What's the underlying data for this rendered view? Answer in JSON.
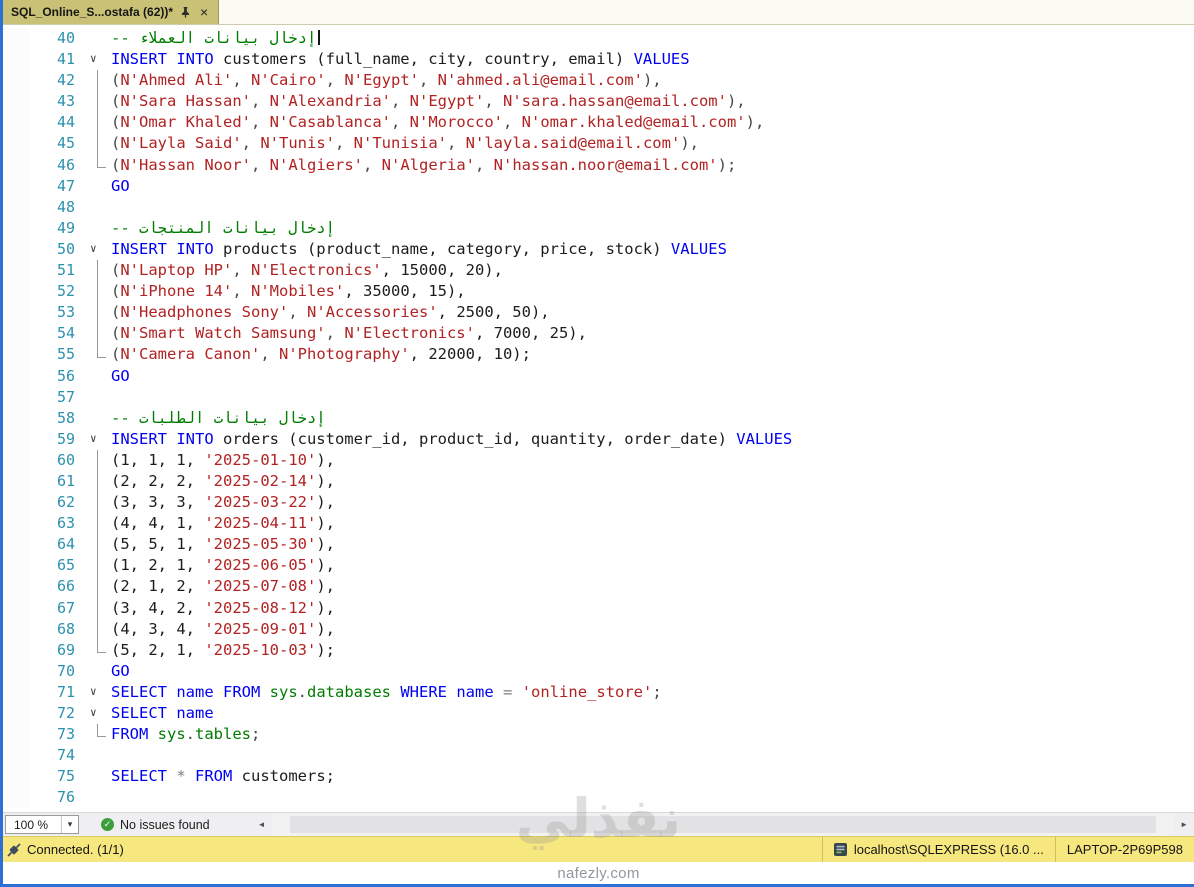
{
  "tab_bar": {
    "title": "SQL_Online_S...ostafa (62))*",
    "close_label": "×"
  },
  "colors": {
    "keyword": "#0000F2",
    "string": "#B22222",
    "comment": "#007C00",
    "line_number": "#2B91AF",
    "tab": "#C9C176",
    "status_bar": "#F6E77E"
  },
  "editor": {
    "lines": [
      {
        "n": 40,
        "g": "",
        "caret": true,
        "s": [
          [
            "-- إدخال بيانات العملاء",
            "c"
          ]
        ]
      },
      {
        "n": 41,
        "g": "start",
        "s": [
          [
            "INSERT INTO",
            "k"
          ],
          [
            " customers (full_name, city, country, email) ",
            "i"
          ],
          [
            "VALUES",
            "k"
          ]
        ]
      },
      {
        "n": 42,
        "g": "mid",
        "s": [
          [
            "(",
            "p"
          ],
          [
            "N'Ahmed Ali'",
            "s"
          ],
          [
            ", ",
            "p"
          ],
          [
            "N'Cairo'",
            "s"
          ],
          [
            ", ",
            "p"
          ],
          [
            "N'Egypt'",
            "s"
          ],
          [
            ", ",
            "p"
          ],
          [
            "N'ahmed.ali@email.com'",
            "s"
          ],
          [
            "),",
            "p"
          ]
        ]
      },
      {
        "n": 43,
        "g": "mid",
        "s": [
          [
            "(",
            "p"
          ],
          [
            "N'Sara Hassan'",
            "s"
          ],
          [
            ", ",
            "p"
          ],
          [
            "N'Alexandria'",
            "s"
          ],
          [
            ", ",
            "p"
          ],
          [
            "N'Egypt'",
            "s"
          ],
          [
            ", ",
            "p"
          ],
          [
            "N'sara.hassan@email.com'",
            "s"
          ],
          [
            "),",
            "p"
          ]
        ]
      },
      {
        "n": 44,
        "g": "mid",
        "s": [
          [
            "(",
            "p"
          ],
          [
            "N'Omar Khaled'",
            "s"
          ],
          [
            ", ",
            "p"
          ],
          [
            "N'Casablanca'",
            "s"
          ],
          [
            ", ",
            "p"
          ],
          [
            "N'Morocco'",
            "s"
          ],
          [
            ", ",
            "p"
          ],
          [
            "N'omar.khaled@email.com'",
            "s"
          ],
          [
            "),",
            "p"
          ]
        ]
      },
      {
        "n": 45,
        "g": "mid",
        "s": [
          [
            "(",
            "p"
          ],
          [
            "N'Layla Said'",
            "s"
          ],
          [
            ", ",
            "p"
          ],
          [
            "N'Tunis'",
            "s"
          ],
          [
            ", ",
            "p"
          ],
          [
            "N'Tunisia'",
            "s"
          ],
          [
            ", ",
            "p"
          ],
          [
            "N'layla.said@email.com'",
            "s"
          ],
          [
            "),",
            "p"
          ]
        ]
      },
      {
        "n": 46,
        "g": "end",
        "s": [
          [
            "(",
            "p"
          ],
          [
            "N'Hassan Noor'",
            "s"
          ],
          [
            ", ",
            "p"
          ],
          [
            "N'Algiers'",
            "s"
          ],
          [
            ", ",
            "p"
          ],
          [
            "N'Algeria'",
            "s"
          ],
          [
            ", ",
            "p"
          ],
          [
            "N'hassan.noor@email.com'",
            "s"
          ],
          [
            ");",
            "p"
          ]
        ]
      },
      {
        "n": 47,
        "g": "",
        "s": [
          [
            "GO",
            "k"
          ]
        ]
      },
      {
        "n": 48,
        "g": "",
        "s": []
      },
      {
        "n": 49,
        "g": "",
        "s": [
          [
            "-- إدخال بيانات المنتجات",
            "c"
          ]
        ]
      },
      {
        "n": 50,
        "g": "start",
        "s": [
          [
            "INSERT INTO",
            "k"
          ],
          [
            " products (product_name, category, price, stock) ",
            "i"
          ],
          [
            "VALUES",
            "k"
          ]
        ]
      },
      {
        "n": 51,
        "g": "mid",
        "s": [
          [
            "(",
            "p"
          ],
          [
            "N'Laptop HP'",
            "s"
          ],
          [
            ", ",
            "p"
          ],
          [
            "N'Electronics'",
            "s"
          ],
          [
            ", 15000, 20),",
            "i"
          ]
        ]
      },
      {
        "n": 52,
        "g": "mid",
        "s": [
          [
            "(",
            "p"
          ],
          [
            "N'iPhone 14'",
            "s"
          ],
          [
            ", ",
            "p"
          ],
          [
            "N'Mobiles'",
            "s"
          ],
          [
            ", 35000, 15),",
            "i"
          ]
        ]
      },
      {
        "n": 53,
        "g": "mid",
        "s": [
          [
            "(",
            "p"
          ],
          [
            "N'Headphones Sony'",
            "s"
          ],
          [
            ", ",
            "p"
          ],
          [
            "N'Accessories'",
            "s"
          ],
          [
            ", 2500, 50),",
            "i"
          ]
        ]
      },
      {
        "n": 54,
        "g": "mid",
        "s": [
          [
            "(",
            "p"
          ],
          [
            "N'Smart Watch Samsung'",
            "s"
          ],
          [
            ", ",
            "p"
          ],
          [
            "N'Electronics'",
            "s"
          ],
          [
            ", 7000, 25),",
            "i"
          ]
        ]
      },
      {
        "n": 55,
        "g": "end",
        "s": [
          [
            "(",
            "p"
          ],
          [
            "N'Camera Canon'",
            "s"
          ],
          [
            ", ",
            "p"
          ],
          [
            "N'Photography'",
            "s"
          ],
          [
            ", 22000, 10);",
            "i"
          ]
        ]
      },
      {
        "n": 56,
        "g": "",
        "s": [
          [
            "GO",
            "k"
          ]
        ]
      },
      {
        "n": 57,
        "g": "",
        "s": []
      },
      {
        "n": 58,
        "g": "",
        "s": [
          [
            "-- إدخال بيانات الطلبات",
            "c"
          ]
        ]
      },
      {
        "n": 59,
        "g": "start",
        "s": [
          [
            "INSERT INTO",
            "k"
          ],
          [
            " orders (customer_id, product_id, quantity, order_date) ",
            "i"
          ],
          [
            "VALUES",
            "k"
          ]
        ]
      },
      {
        "n": 60,
        "g": "mid",
        "s": [
          [
            "(1, 1, 1, ",
            "i"
          ],
          [
            "'2025-01-10'",
            "s"
          ],
          [
            "),",
            "i"
          ]
        ]
      },
      {
        "n": 61,
        "g": "mid",
        "s": [
          [
            "(2, 2, 2, ",
            "i"
          ],
          [
            "'2025-02-14'",
            "s"
          ],
          [
            "),",
            "i"
          ]
        ]
      },
      {
        "n": 62,
        "g": "mid",
        "s": [
          [
            "(3, 3, 3, ",
            "i"
          ],
          [
            "'2025-03-22'",
            "s"
          ],
          [
            "),",
            "i"
          ]
        ]
      },
      {
        "n": 63,
        "g": "mid",
        "s": [
          [
            "(4, 4, 1, ",
            "i"
          ],
          [
            "'2025-04-11'",
            "s"
          ],
          [
            "),",
            "i"
          ]
        ]
      },
      {
        "n": 64,
        "g": "mid",
        "s": [
          [
            "(5, 5, 1, ",
            "i"
          ],
          [
            "'2025-05-30'",
            "s"
          ],
          [
            "),",
            "i"
          ]
        ]
      },
      {
        "n": 65,
        "g": "mid",
        "s": [
          [
            "(1, 2, 1, ",
            "i"
          ],
          [
            "'2025-06-05'",
            "s"
          ],
          [
            "),",
            "i"
          ]
        ]
      },
      {
        "n": 66,
        "g": "mid",
        "s": [
          [
            "(2, 1, 2, ",
            "i"
          ],
          [
            "'2025-07-08'",
            "s"
          ],
          [
            "),",
            "i"
          ]
        ]
      },
      {
        "n": 67,
        "g": "mid",
        "s": [
          [
            "(3, 4, 2, ",
            "i"
          ],
          [
            "'2025-08-12'",
            "s"
          ],
          [
            "),",
            "i"
          ]
        ]
      },
      {
        "n": 68,
        "g": "mid",
        "s": [
          [
            "(4, 3, 4, ",
            "i"
          ],
          [
            "'2025-09-01'",
            "s"
          ],
          [
            "),",
            "i"
          ]
        ]
      },
      {
        "n": 69,
        "g": "end",
        "s": [
          [
            "(5, 2, 1, ",
            "i"
          ],
          [
            "'2025-10-03'",
            "s"
          ],
          [
            ");",
            "i"
          ]
        ]
      },
      {
        "n": 70,
        "g": "",
        "s": [
          [
            "GO",
            "k"
          ]
        ]
      },
      {
        "n": 71,
        "g": "start",
        "s": [
          [
            "SELECT name FROM",
            "k"
          ],
          [
            " ",
            "p"
          ],
          [
            "sys",
            "g"
          ],
          [
            ".",
            "p"
          ],
          [
            "databases",
            "g"
          ],
          [
            " ",
            "p"
          ],
          [
            "WHERE name",
            "k"
          ],
          [
            " ",
            "p"
          ],
          [
            "=",
            "o"
          ],
          [
            " ",
            "p"
          ],
          [
            "'online_store'",
            "s"
          ],
          [
            ";",
            "p"
          ]
        ]
      },
      {
        "n": 72,
        "g": "start",
        "s": [
          [
            "SELECT name",
            "k"
          ]
        ]
      },
      {
        "n": 73,
        "g": "end",
        "s": [
          [
            "FROM",
            "k"
          ],
          [
            " ",
            "p"
          ],
          [
            "sys",
            "g"
          ],
          [
            ".",
            "p"
          ],
          [
            "tables",
            "g"
          ],
          [
            ";",
            "p"
          ]
        ]
      },
      {
        "n": 74,
        "g": "",
        "s": []
      },
      {
        "n": 75,
        "g": "",
        "s": [
          [
            "SELECT",
            "k"
          ],
          [
            " * ",
            "o"
          ],
          [
            "FROM",
            "k"
          ],
          [
            " customers;",
            "i"
          ]
        ]
      },
      {
        "n": 76,
        "g": "",
        "s": []
      }
    ]
  },
  "bottom": {
    "zoom": "100 %",
    "issues": "No issues found"
  },
  "status": {
    "connected": "Connected. (1/1)",
    "server": "localhost\\SQLEXPRESS (16.0 ...",
    "host": "LAPTOP-2P69P598"
  },
  "watermark": {
    "arabic": "نفذلي",
    "site": "nafezly.com"
  }
}
